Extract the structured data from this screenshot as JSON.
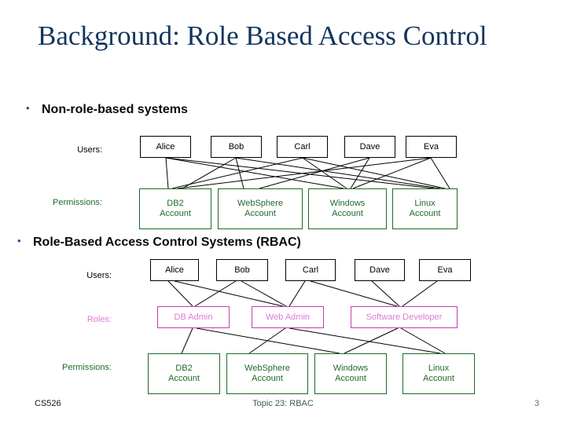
{
  "slide": {
    "title": "Background: Role Based Access Control",
    "bullets": [
      {
        "marker": "•",
        "text": "Non-role-based systems"
      },
      {
        "marker": "•",
        "text": "Role-Based Access Control Systems (RBAC)"
      }
    ]
  },
  "colors": {
    "title": "#13355e",
    "bullet_marker": "#2b4a8b",
    "bullet_text": "#0a0a0a",
    "user_box": "#000000",
    "permission_box": "#1d6b2a",
    "permission_text": "#1d6b2a",
    "role_box": "#c23fb0",
    "role_text": "#e07ad0",
    "edge": "#000000",
    "footer_center": "#3d5c4a",
    "footer_page": "#6b6b6b"
  },
  "diagram_non_rbac": {
    "row_labels": {
      "users": "Users:",
      "permissions": "Permissions:"
    },
    "users": [
      "Alice",
      "Bob",
      "Carl",
      "Dave",
      "Eva"
    ],
    "permissions": [
      {
        "line1": "DB2",
        "line2": "Account"
      },
      {
        "line1": "WebSphere",
        "line2": "Account"
      },
      {
        "line1": "Windows",
        "line2": "Account"
      },
      {
        "line1": "Linux",
        "line2": "Account"
      }
    ],
    "edges": [
      {
        "from": "Alice",
        "to": "DB2 Account"
      },
      {
        "from": "Alice",
        "to": "Windows Account"
      },
      {
        "from": "Alice",
        "to": "Linux Account"
      },
      {
        "from": "Bob",
        "to": "DB2 Account"
      },
      {
        "from": "Bob",
        "to": "WebSphere Account"
      },
      {
        "from": "Bob",
        "to": "Linux Account"
      },
      {
        "from": "Carl",
        "to": "DB2 Account"
      },
      {
        "from": "Carl",
        "to": "Windows Account"
      },
      {
        "from": "Carl",
        "to": "Linux Account"
      },
      {
        "from": "Dave",
        "to": "WebSphere Account"
      },
      {
        "from": "Dave",
        "to": "Windows Account"
      },
      {
        "from": "Eva",
        "to": "DB2 Account"
      },
      {
        "from": "Eva",
        "to": "Windows Account"
      },
      {
        "from": "Eva",
        "to": "Linux Account"
      }
    ]
  },
  "diagram_rbac": {
    "row_labels": {
      "users": "Users:",
      "roles": "Roles:",
      "permissions": "Permissions:"
    },
    "users": [
      "Alice",
      "Bob",
      "Carl",
      "Dave",
      "Eva"
    ],
    "roles": [
      "DB Admin",
      "Web Admin",
      "Software Developer"
    ],
    "permissions": [
      {
        "line1": "DB2",
        "line2": "Account"
      },
      {
        "line1": "WebSphere",
        "line2": "Account"
      },
      {
        "line1": "Windows",
        "line2": "Account"
      },
      {
        "line1": "Linux",
        "line2": "Account"
      }
    ],
    "user_role_edges": [
      {
        "from": "Alice",
        "to": "DB Admin"
      },
      {
        "from": "Alice",
        "to": "Web Admin"
      },
      {
        "from": "Bob",
        "to": "DB Admin"
      },
      {
        "from": "Bob",
        "to": "Web Admin"
      },
      {
        "from": "Carl",
        "to": "Web Admin"
      },
      {
        "from": "Carl",
        "to": "Software Developer"
      },
      {
        "from": "Dave",
        "to": "Software Developer"
      },
      {
        "from": "Eva",
        "to": "Software Developer"
      }
    ],
    "role_permission_edges": [
      {
        "from": "DB Admin",
        "to": "DB2 Account"
      },
      {
        "from": "DB Admin",
        "to": "Windows Account"
      },
      {
        "from": "Web Admin",
        "to": "WebSphere Account"
      },
      {
        "from": "Web Admin",
        "to": "Linux Account"
      },
      {
        "from": "Software Developer",
        "to": "WebSphere Account"
      },
      {
        "from": "Software Developer",
        "to": "Linux Account"
      }
    ]
  },
  "footer": {
    "course": "CS526",
    "topic": "Topic 23: RBAC",
    "page_number": "3"
  }
}
